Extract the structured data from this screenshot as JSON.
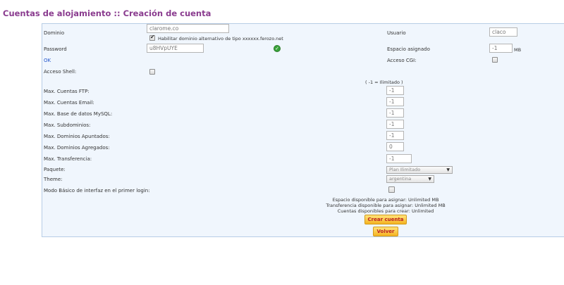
{
  "page": {
    "title": "Cuentas de alojamiento :: Creación de cuenta"
  },
  "form": {
    "dominio_label": "Dominio",
    "dominio_value": "clarome.co",
    "alt_domain_label": "Habilitar dominio alternativo de tipo xxxxxx.ferozo.net",
    "usuario_label": "Usuario",
    "usuario_value": "claco",
    "password_label": "Password",
    "password_value": "u8HVpUYE",
    "espacio_label": "Espacio asignado",
    "espacio_value": "-1",
    "espacio_unit": "MB",
    "ok_text": "OK",
    "cgi_label": "Acceso CGI:",
    "shell_label": "Acceso Shell:",
    "ilimitado_note": "( -1 = Ilimitado )",
    "limits": [
      {
        "label": "Max. Cuentas FTP:",
        "value": "-1"
      },
      {
        "label": "Max. Cuentas Email:",
        "value": "-1"
      },
      {
        "label": "Max. Base de datos MySQL:",
        "value": "-1"
      },
      {
        "label": "Max. Subdominios:",
        "value": "-1"
      },
      {
        "label": "Max. Dominios Apuntados:",
        "value": "-1"
      },
      {
        "label": "Max. Dominios Agregados:",
        "value": "0"
      },
      {
        "label": "Max. Transferencia:",
        "value": "-1"
      }
    ],
    "paquete_label": "Paquete:",
    "paquete_value": "Plan Ilimitado",
    "theme_label": "Theme:",
    "theme_value": "argentina",
    "modo_basico_label": "Modo Básico de interfaz en el primer login:",
    "info_lines": [
      "Espacio disponible para asignar: Unlimited MB",
      "Transferencia disponible para asignar: Unlimited MB",
      "Cuentas disponibles para crear: Unlimited"
    ],
    "crear_button": "Crear cuenta",
    "volver_button": "Volver"
  },
  "colors": {
    "title": "#8a3c8f",
    "panel_bg": "#f0f6fd",
    "panel_border": "#b7cde6",
    "ok_link": "#2255cc",
    "button_gradient_top": "#ffe37a",
    "button_gradient_bottom": "#f5b321",
    "button_text": "#b22222"
  },
  "icons": {
    "password_ok": "check-circle-icon",
    "select_arrow": "triangle-down-icon"
  }
}
